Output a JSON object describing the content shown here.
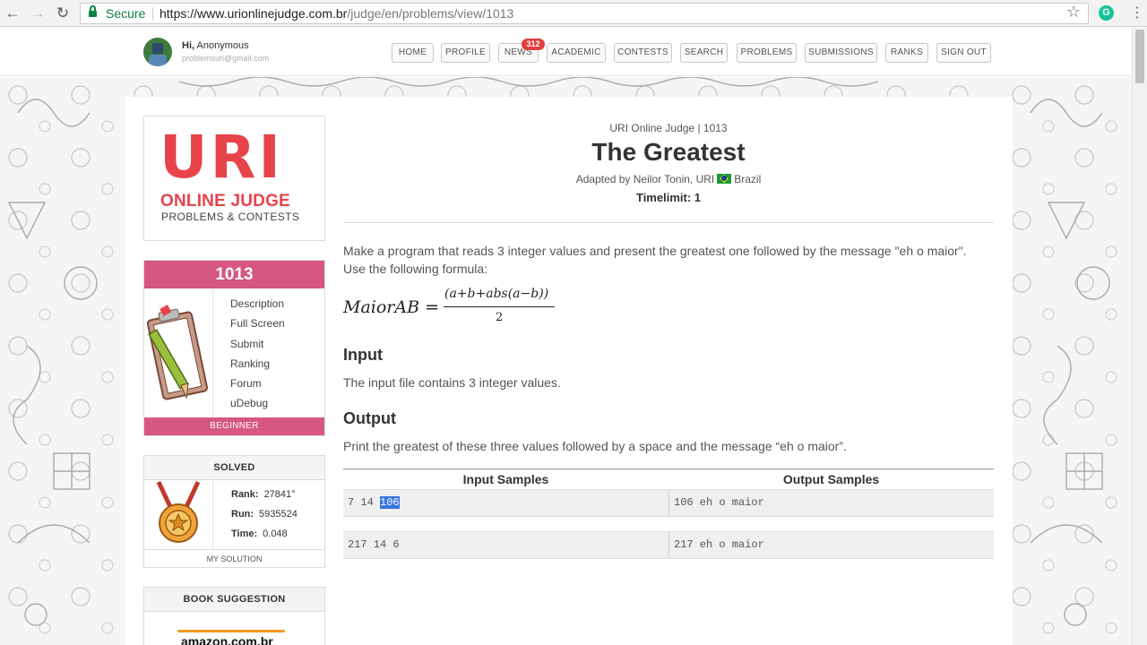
{
  "browser": {
    "secure_label": "Secure",
    "url_host": "https://www.urionlinejudge.com.br",
    "url_path": "/judge/en/problems/view/1013",
    "extension_letter": "G"
  },
  "user": {
    "greeting": "Hi,",
    "name": "Anonymous",
    "email": "problemsuri@gmail.com"
  },
  "menu": {
    "items": [
      {
        "label": "HOME"
      },
      {
        "label": "PROFILE"
      },
      {
        "label": "NEWS"
      },
      {
        "label": "ACADEMIC"
      },
      {
        "label": "CONTESTS"
      },
      {
        "label": "SEARCH"
      },
      {
        "label": "PROBLEMS"
      },
      {
        "label": "SUBMISSIONS"
      },
      {
        "label": "RANKS"
      },
      {
        "label": "SIGN OUT"
      }
    ],
    "news_badge": "312"
  },
  "logo": {
    "title": "URI",
    "subtitle": "ONLINE JUDGE",
    "tagline": "PROBLEMS & CONTESTS"
  },
  "problem_box": {
    "id": "1013",
    "links": [
      "Description",
      "Full Screen",
      "Submit",
      "Ranking",
      "Forum",
      "uDebug"
    ],
    "level": "BEGINNER"
  },
  "solved": {
    "header": "SOLVED",
    "rank_label": "Rank:",
    "rank_value": "27841°",
    "run_label": "Run:",
    "run_value": "5935524",
    "time_label": "Time:",
    "time_value": "0.048",
    "footer": "MY SOLUTION"
  },
  "book": {
    "header": "BOOK SUGGESTION",
    "amazon": "amazon.com.br"
  },
  "problem": {
    "breadcrumb": "URI Online Judge | 1013",
    "title": "The Greatest",
    "adapted_prefix": "Adapted by Neilor Tonin, URI",
    "country": "Brazil",
    "timelimit": "Timelimit: 1",
    "description_line1": "Make a program that reads 3 integer values and present the greatest one followed by the message \"eh o maior\".",
    "description_line2": "Use the following formula:",
    "formula_lhs": "MaiorAB =",
    "formula_numerator": "(a+b+abs(a−b))",
    "formula_denominator": "2",
    "input_heading": "Input",
    "input_text": "The input file contains 3 integer values.",
    "output_heading": "Output",
    "output_text": "Print the greatest of these three values followed by a space and the message “eh o maior”."
  },
  "samples": {
    "input_header": "Input Samples",
    "output_header": "Output Samples",
    "rows": [
      {
        "input_prefix": "7 14 ",
        "input_selected": "106",
        "output": "106 eh o maior"
      },
      {
        "input_prefix": "217 14 6",
        "input_selected": "",
        "output": "217 eh o maior"
      }
    ]
  },
  "colors": {
    "brand_red": "#e8434b",
    "problem_pink": "#d6577f",
    "secure_green": "#0b8043",
    "selection_blue": "#3574e3"
  }
}
